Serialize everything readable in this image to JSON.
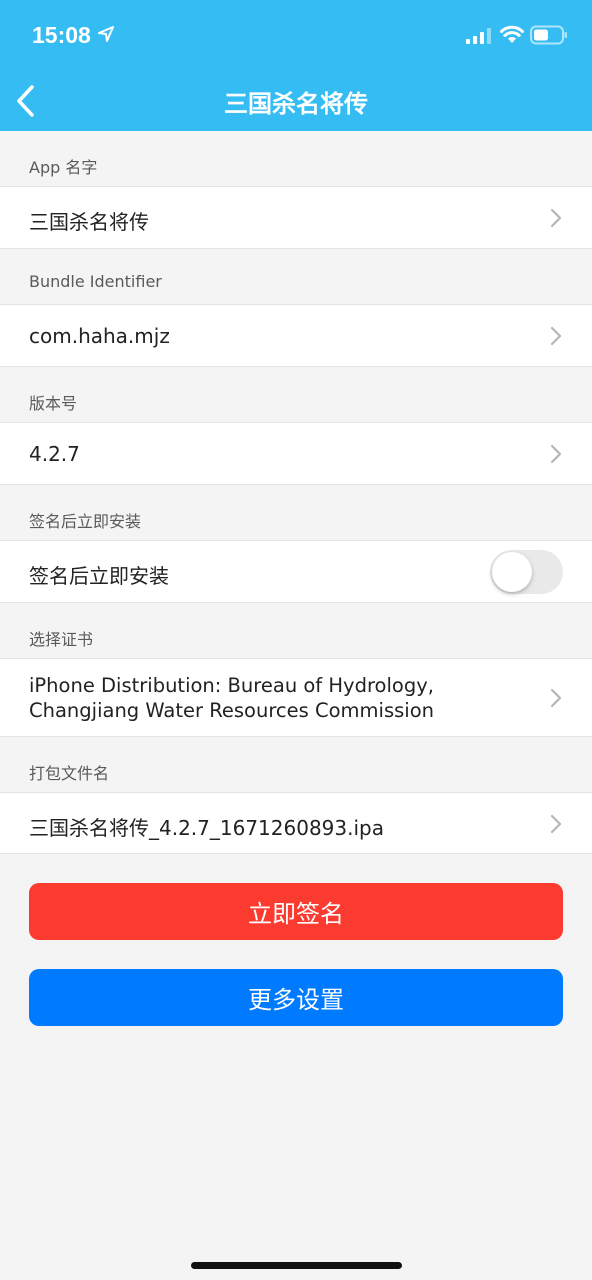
{
  "status_bar": {
    "time": "15:08"
  },
  "nav": {
    "title": "三国杀名将传"
  },
  "sections": {
    "app_name": {
      "label": "App 名字",
      "value": "三国杀名将传"
    },
    "bundle_id": {
      "label": "Bundle Identifier",
      "value": "com.haha.mjz"
    },
    "version": {
      "label": "版本号",
      "value": "4.2.7"
    },
    "install": {
      "label": "签名后立即安装",
      "value": "签名后立即安装",
      "toggle_on": false
    },
    "certificate": {
      "label": "选择证书",
      "value": "iPhone Distribution: Bureau of Hydrology, Changjiang Water Resources Commission"
    },
    "package_name": {
      "label": "打包文件名",
      "value": "三国杀名将传_4.2.7_1671260893.ipa"
    }
  },
  "buttons": {
    "sign_now": "立即签名",
    "more_settings": "更多设置"
  },
  "colors": {
    "header": "#35bdf3",
    "sign_button": "#fc3b30",
    "more_button": "#007afe",
    "background": "#f4f4f4"
  },
  "icons": [
    "location-arrow-icon",
    "signal-icon",
    "wifi-icon",
    "battery-icon",
    "back-chevron-icon",
    "chevron-right-icon"
  ]
}
